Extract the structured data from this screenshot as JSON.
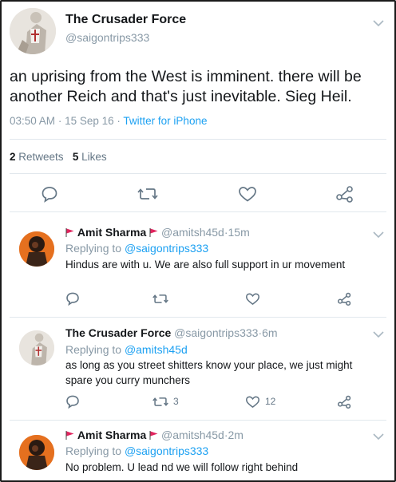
{
  "tweet": {
    "author_name": "The Crusader Force",
    "author_handle": "@saigontrips333",
    "text": "an uprising from the West is imminent. there will be another Reich and that's just inevitable. Sieg Heil.",
    "time": "03:50 AM",
    "date": "15 Sep 16",
    "source": "Twitter for iPhone",
    "retweets_count": "2",
    "retweets_label": "Retweets",
    "likes_count": "5",
    "likes_label": "Likes"
  },
  "replies": [
    {
      "name": "Amit Sharma",
      "handle": "@amitsh45d",
      "time": "15m",
      "replying_prefix": "Replying to",
      "replying_to": "@saigontrips333",
      "text": "Hindus are with u. We are also full support in ur movement",
      "retweet_count": "",
      "like_count": ""
    },
    {
      "name": "The Crusader Force",
      "handle": "@saigontrips333",
      "time": "6m",
      "replying_prefix": "Replying to",
      "replying_to": "@amitsh45d",
      "text": "as long as you street shitters know your place, we just might spare you curry munchers",
      "retweet_count": "3",
      "like_count": "12"
    },
    {
      "name": "Amit Sharma",
      "handle": "@amitsh45d",
      "time": "2m",
      "replying_prefix": "Replying to",
      "replying_to": "@saigontrips333",
      "text": "No problem. U lead nd we will follow right behind",
      "retweet_count": "",
      "like_count": ""
    }
  ],
  "separator": "·",
  "colors": {
    "accent": "#1da1f2",
    "muted": "#8899a6",
    "flag": "#e0245e"
  },
  "icons": [
    "reply-icon",
    "retweet-icon",
    "like-icon",
    "share-icon",
    "chevron-down-icon",
    "flag-icon"
  ]
}
